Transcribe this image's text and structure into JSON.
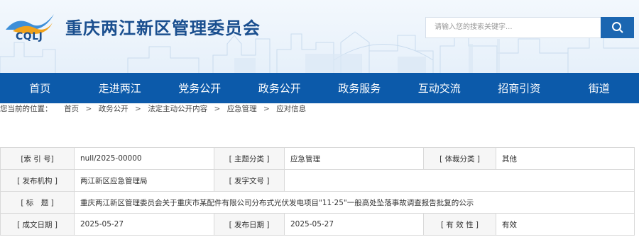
{
  "header": {
    "logo_text": "CQLJ",
    "site_title": "重庆两江新区管理委员会",
    "search_placeholder": "请输入您的搜索关键字..."
  },
  "nav": {
    "items": [
      "首页",
      "走进两江",
      "党务公开",
      "政务公开",
      "政务服务",
      "互动交流",
      "招商引资",
      "街道"
    ]
  },
  "breadcrumb": {
    "prefix": "您当前的位置：",
    "items": [
      "首页",
      "政务公开",
      "法定主动公开内容",
      "应急管理",
      "应对信息"
    ],
    "separator": ">"
  },
  "meta": {
    "row1": {
      "l1": "[索 引 号]",
      "v1": "null/2025-00000",
      "l2": "[ 主题分类 ]",
      "v2": "应急管理",
      "l3": "[ 体裁分类 ]",
      "v3": "其他"
    },
    "row2": {
      "l1": "[ 发布机构 ]",
      "v1": "两江新区应急管理局",
      "l2": "[ 发字文号 ]",
      "v2": ""
    },
    "row3": {
      "l1": "[ 标　题 ]",
      "v1": "重庆两江新区管理委员会关于重庆市某配件有限公司分布式光伏发电项目\"11·25\"一般高处坠落事故调查报告批复的公示"
    },
    "row4": {
      "l1": "[ 成文日期 ]",
      "v1": "2025-05-27",
      "l2": "[ 发布日期 ]",
      "v2": "2025-05-27",
      "l3": "[ 有 效 性 ]",
      "v3": "有效"
    }
  },
  "colors": {
    "nav_bg": "#0c5aaa",
    "title": "#1a4f8f",
    "search_button": "#1b66b1"
  }
}
